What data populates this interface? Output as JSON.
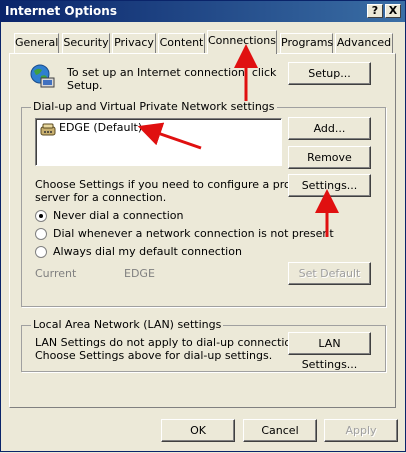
{
  "window": {
    "title": "Internet Options",
    "help_button": "?",
    "close_button": "X"
  },
  "tabs": [
    {
      "label": "General",
      "active": false
    },
    {
      "label": "Security",
      "active": false
    },
    {
      "label": "Privacy",
      "active": false
    },
    {
      "label": "Content",
      "active": false
    },
    {
      "label": "Connections",
      "active": true
    },
    {
      "label": "Programs",
      "active": false
    },
    {
      "label": "Advanced",
      "active": false
    }
  ],
  "setup": {
    "text_line1": "To set up an Internet connection, click",
    "text_line2": "Setup.",
    "button": "Setup..."
  },
  "dialup": {
    "legend": "Dial-up and Virtual Private Network settings",
    "connections": [
      {
        "name": "EDGE (Default)",
        "icon": "dialup-connection-icon"
      }
    ],
    "add_button": "Add...",
    "remove_button": "Remove",
    "settings_button": "Settings...",
    "choose_text_line1": "Choose Settings if you need to configure a proxy",
    "choose_text_line2": "server for a connection.",
    "radio_options": [
      {
        "label": "Never dial a connection",
        "selected": true
      },
      {
        "label": "Dial whenever a network connection is not present",
        "selected": false
      },
      {
        "label": "Always dial my default connection",
        "selected": false
      }
    ],
    "current_label": "Current",
    "current_value": "EDGE",
    "set_default_button": "Set Default"
  },
  "lan": {
    "legend": "Local Area Network (LAN) settings",
    "text_line1": "LAN Settings do not apply to dial-up connections.",
    "text_line2": "Choose Settings above for dial-up settings.",
    "button": "LAN Settings..."
  },
  "footer": {
    "ok": "OK",
    "cancel": "Cancel",
    "apply": "Apply"
  },
  "colors": {
    "annotation_arrow": "#e01010",
    "titlebar": "#0a246a",
    "face": "#ece9d8"
  }
}
